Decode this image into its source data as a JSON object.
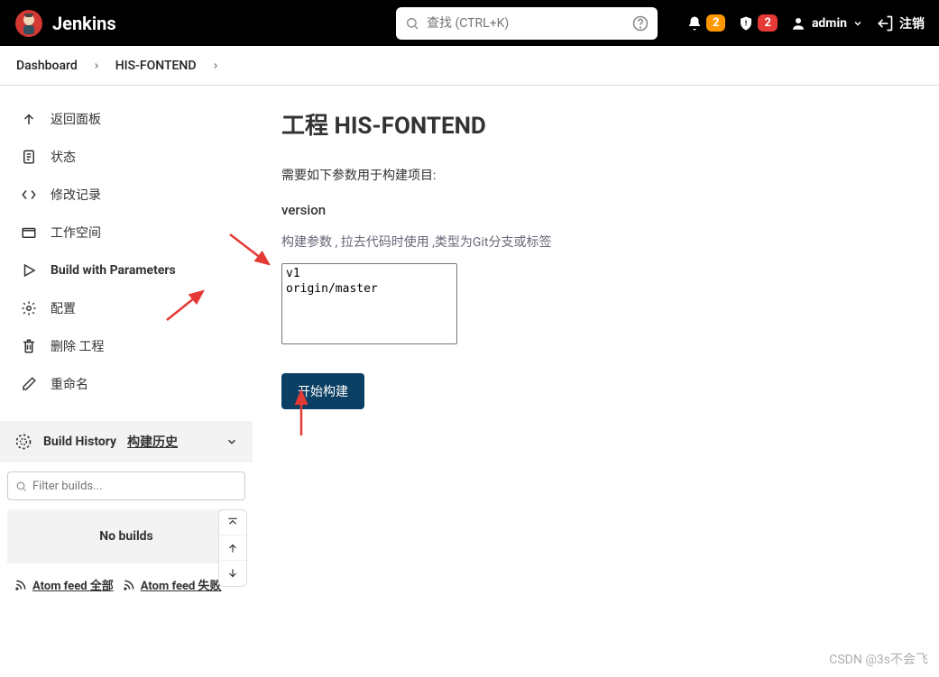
{
  "header": {
    "title": "Jenkins",
    "search_placeholder": "查找 (CTRL+K)",
    "notif1_count": "2",
    "notif2_count": "2",
    "user": "admin",
    "logout": "注销"
  },
  "breadcrumb": {
    "items": [
      "Dashboard",
      "HIS-FONTEND"
    ]
  },
  "sidebar": {
    "items": [
      {
        "icon": "arrow-up-left",
        "label": "返回面板"
      },
      {
        "icon": "doc",
        "label": "状态"
      },
      {
        "icon": "code",
        "label": "修改记录"
      },
      {
        "icon": "folder",
        "label": "工作空间"
      },
      {
        "icon": "play",
        "label": "Build with Parameters",
        "bold": true
      },
      {
        "icon": "gear",
        "label": "配置"
      },
      {
        "icon": "trash",
        "label": "删除 工程"
      },
      {
        "icon": "pencil",
        "label": "重命名"
      }
    ],
    "history_title": "Build History",
    "history_sub": "构建历史",
    "filter_placeholder": "Filter builds...",
    "no_builds": "No builds",
    "feed_all": "Atom feed 全部",
    "feed_fail": "Atom feed 失败"
  },
  "content": {
    "title": "工程 HIS-FONTEND",
    "intro": "需要如下参数用于构建项目:",
    "param_name": "version",
    "param_desc": "构建参数 , 拉去代码时使用 ,类型为Git分支或标签",
    "options": [
      "v1",
      "origin/master"
    ],
    "build_btn": "开始构建"
  },
  "watermark": "CSDN @3s不会飞"
}
